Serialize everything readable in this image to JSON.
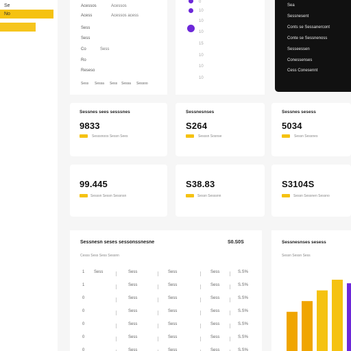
{
  "sidebar": {
    "items": [
      {
        "label": "Se"
      },
      {
        "label": "No"
      },
      {
        "label": ""
      }
    ]
  },
  "filters": {
    "rows": [
      {
        "label": "Acessos",
        "value": "Acessos"
      },
      {
        "label": "Acess",
        "value": "Acessos acess"
      },
      {
        "label": "Sess",
        "value": ""
      },
      {
        "label": "Sess",
        "value": ""
      },
      {
        "label": "Co",
        "value": "Sess"
      },
      {
        "label": "Ro",
        "value": ""
      },
      {
        "label": "Reseso",
        "value": ""
      }
    ],
    "footer": [
      "Sess",
      "Sessa",
      "Sess",
      "Sessa",
      "Sessoo"
    ]
  },
  "timeline": {
    "ticks": [
      "0",
      "10",
      "10",
      "10",
      "15",
      "10",
      "10",
      "10"
    ]
  },
  "menu": {
    "items": [
      "Sea",
      "Sessnesent",
      "Conts se Sessanercont",
      "Conte se Sessnenoss",
      "Sesseessen",
      "Conessenses",
      "Cess Conesennt"
    ]
  },
  "kpis": [
    {
      "title": "Sessnes sees sesssnes",
      "value": "9833",
      "sub": "Sesssnoos Sessn Sees"
    },
    {
      "title": "Sessnesnses",
      "value": "S264",
      "sub": "Sesssn Sosnse"
    },
    {
      "title": "Sessnes sesess",
      "value": "5034",
      "sub": "Sessn Sessnes"
    },
    {
      "title": "",
      "value": "99.445",
      "sub": "Sesssn Sessn Sessnsn"
    },
    {
      "title": "",
      "value": "S38.83",
      "sub": "Sessn Sesssnn"
    },
    {
      "title": "",
      "value": "S3104S",
      "sub": "Sessn Sessnen Sessno"
    }
  ],
  "table": {
    "title": "Sessnesn seses sessonssnesne",
    "total": "S0.S0S",
    "subtitle": "Cesss Sess Sess Sessnn",
    "rows": [
      {
        "c1": "1",
        "c2": "Sess",
        "c3": "Sess",
        "c4": "Sess",
        "c5": "Sess",
        "c6": "S.S%"
      },
      {
        "c1": "1",
        "c2": "",
        "c3": "Sess",
        "c4": "Sess",
        "c5": "Sess",
        "c6": "S.S%"
      },
      {
        "c1": "0",
        "c2": "",
        "c3": "Sess",
        "c4": "Sess",
        "c5": "Sess",
        "c6": "S.S%"
      },
      {
        "c1": "0",
        "c2": "",
        "c3": "Sess",
        "c4": "Sess",
        "c5": "Sess",
        "c6": "S.S%"
      },
      {
        "c1": "0",
        "c2": "",
        "c3": "Sess",
        "c4": "Sess",
        "c5": "Sess",
        "c6": "S.S%"
      },
      {
        "c1": "0",
        "c2": "",
        "c3": "Sess",
        "c4": "Sess",
        "c5": "Sess",
        "c6": "S.S%"
      },
      {
        "c1": "0",
        "c2": "",
        "c3": "Sess",
        "c4": "Sess",
        "c5": "Sess",
        "c6": "S.S%"
      }
    ]
  },
  "chart_panel": {
    "title": "Sessnesnses sesess",
    "subtitle": "Sessn Sessn Sess"
  },
  "colors": {
    "accent": "#f5c211",
    "accent_dark": "#f0a500",
    "purple": "#6d28d9",
    "dark": "#111111"
  },
  "chart_data": {
    "type": "bar",
    "categories": [
      "",
      "",
      "",
      "",
      ""
    ],
    "series": [
      {
        "values": [
          0.55,
          0.7,
          0.85,
          1.0,
          0.95
        ]
      }
    ],
    "colors": [
      "#f0a500",
      "#f0a500",
      "#f5c211",
      "#f5c211",
      "#6d28d9"
    ],
    "ylim": [
      0,
      1
    ]
  }
}
